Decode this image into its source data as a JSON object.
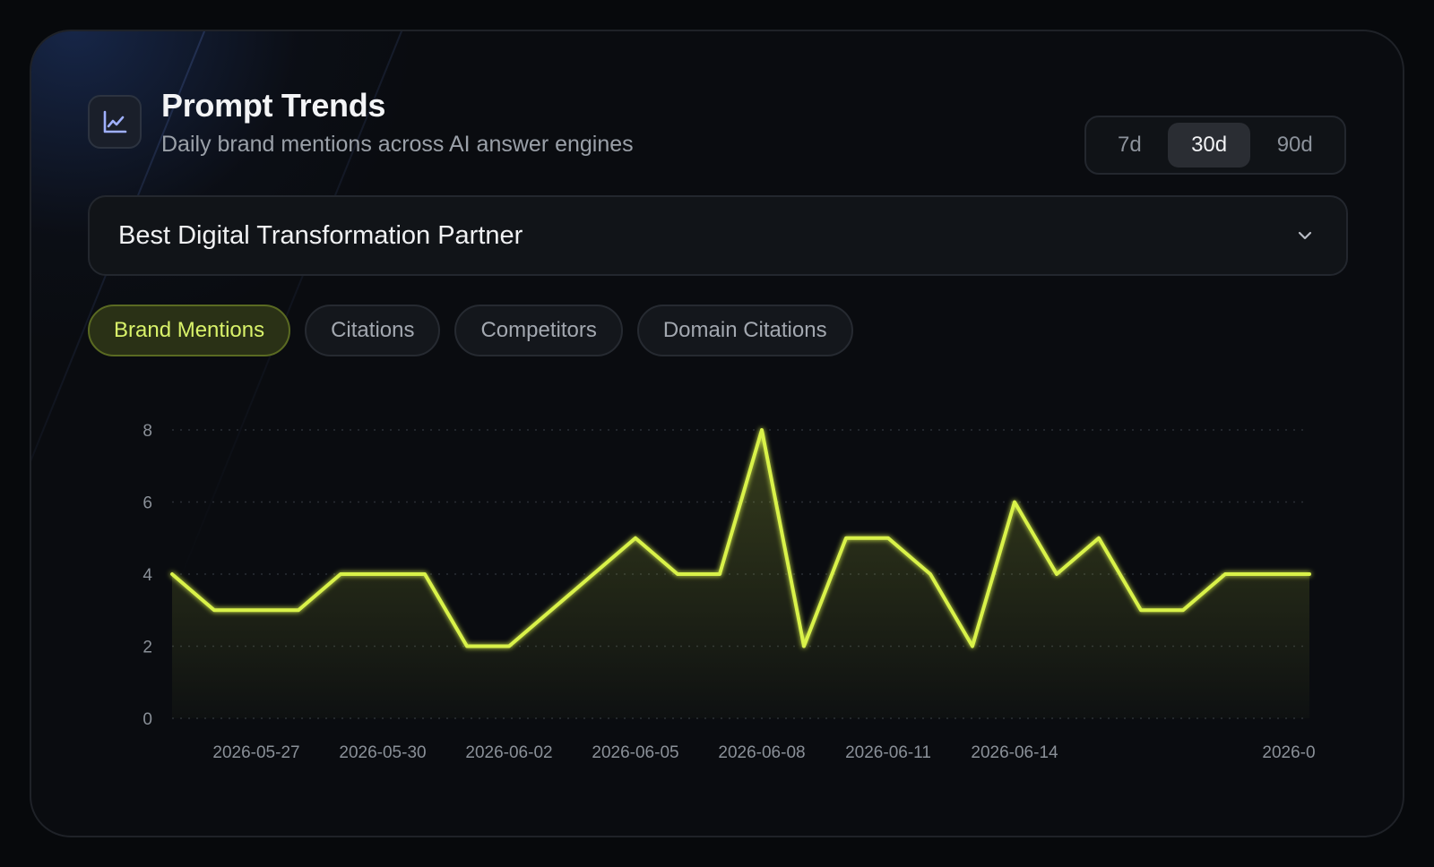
{
  "header": {
    "title": "Prompt Trends",
    "subtitle": "Daily brand mentions across AI answer engines",
    "icon": "line-chart-icon"
  },
  "range": {
    "options": [
      "7d",
      "30d",
      "90d"
    ],
    "selected": "30d"
  },
  "prompt_select": {
    "value": "Best Digital Transformation Partner",
    "icon": "chevron-down-icon"
  },
  "tabs": [
    {
      "label": "Brand Mentions",
      "active": true
    },
    {
      "label": "Citations",
      "active": false
    },
    {
      "label": "Competitors",
      "active": false
    },
    {
      "label": "Domain Citations",
      "active": false
    }
  ],
  "colors": {
    "accent": "#d9f24a",
    "background": "#0a0c10",
    "grid": "#2a2e35"
  },
  "chart_data": {
    "type": "area",
    "x": [
      "2026-05-25",
      "2026-05-26",
      "2026-05-27",
      "2026-05-28",
      "2026-05-29",
      "2026-05-30",
      "2026-05-31",
      "2026-06-01",
      "2026-06-02",
      "2026-06-03",
      "2026-06-04",
      "2026-06-05",
      "2026-06-06",
      "2026-06-07",
      "2026-06-08",
      "2026-06-09",
      "2026-06-10",
      "2026-06-11",
      "2026-06-12",
      "2026-06-13",
      "2026-06-14",
      "2026-06-15",
      "2026-06-16",
      "2026-06-17",
      "2026-06-18",
      "2026-06-19",
      "2026-06-20",
      "2026-06-21"
    ],
    "values": [
      4,
      3,
      3,
      3,
      4,
      4,
      4,
      2,
      2,
      3,
      4,
      5,
      4,
      4,
      8,
      2,
      5,
      5,
      4,
      2,
      6,
      4,
      5,
      3,
      3,
      4,
      4,
      4
    ],
    "x_tick_labels": [
      "2026-05-27",
      "2026-05-30",
      "2026-06-02",
      "2026-06-05",
      "2026-06-08",
      "2026-06-11",
      "2026-06-14",
      "2026-0"
    ],
    "y_ticks": [
      0,
      2,
      4,
      6,
      8
    ],
    "ylim": [
      0,
      8
    ],
    "grid": true,
    "legend": "none"
  }
}
